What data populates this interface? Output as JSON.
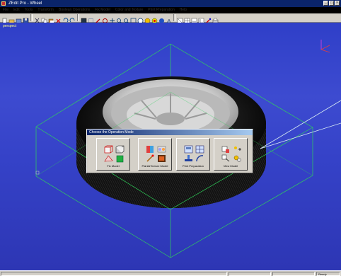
{
  "window": {
    "title": "ZEdit Pro - Wheel",
    "min_glyph": "_",
    "max_glyph": "□",
    "close_glyph": "×"
  },
  "menu": [
    "File",
    "Edit",
    "Tools",
    "Transform",
    "Boolean Operations",
    "Fix Model",
    "Color and Texture",
    "Print Preparation",
    "Help"
  ],
  "viewport": {
    "label": "perspect"
  },
  "dialog": {
    "title": "Choose the Operation Mode",
    "buttons": [
      {
        "label": "Fix Model"
      },
      {
        "label": "Paint&Texture Model"
      },
      {
        "label": "Print Preparation"
      },
      {
        "label": "View Model"
      }
    ]
  },
  "status": {
    "right_text": "Ready"
  },
  "colors": {
    "viewport_bg": "#3542c8",
    "bounding_box": "#2fd35a",
    "titlebar": "#0a246a"
  }
}
